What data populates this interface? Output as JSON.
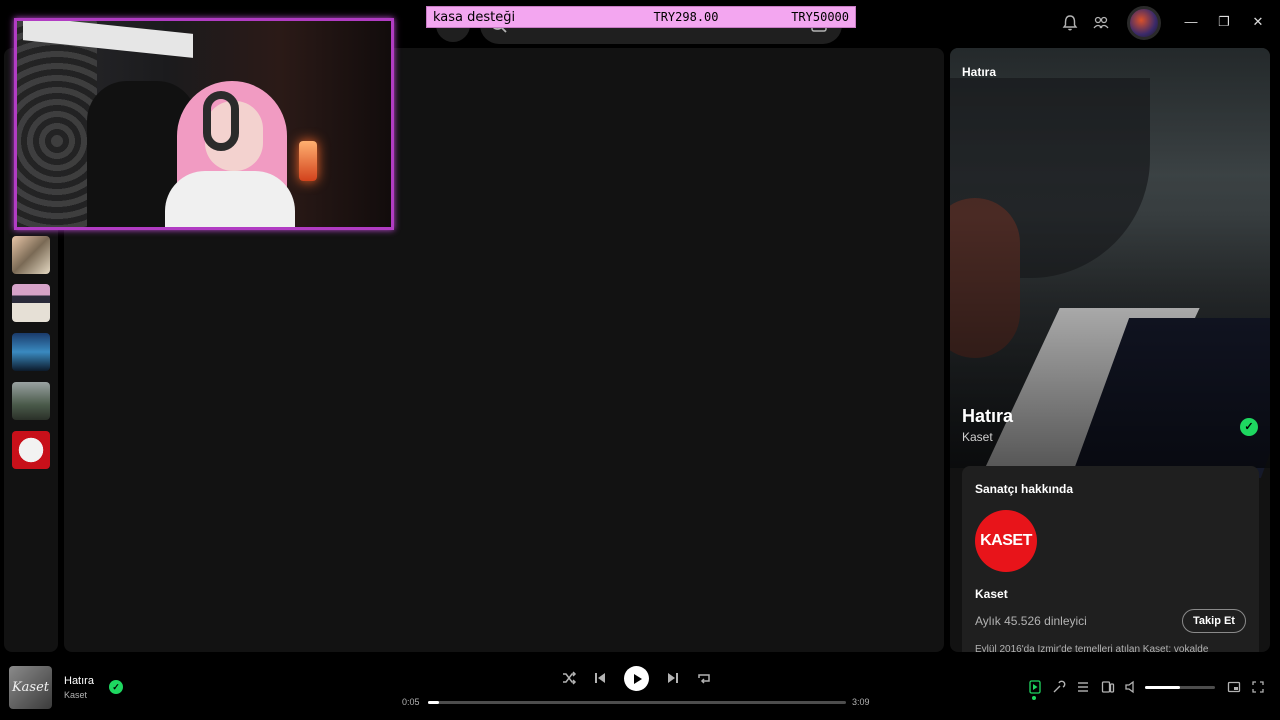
{
  "donation_overlay": {
    "title": "kasa desteği",
    "amount": "TRY298.00",
    "goal": "TRY50000"
  },
  "icons": {
    "home": "home-icon",
    "search": "search-icon",
    "browse": "browse-icon",
    "notifications": "bell-icon",
    "friends": "friends-icon",
    "minimize": "minimize-icon",
    "restore": "restore-icon",
    "close": "close-icon"
  },
  "right_panel": {
    "header": "Hatıra",
    "song_title": "Hatıra",
    "artist": "Kaset",
    "about_title": "Sanatçı hakkında",
    "about_logo_text": "KASET",
    "about_artist_name": "Kaset",
    "monthly_listeners": "Aylık 45.526 dinleyici",
    "follow_button": "Takip Et",
    "bio": "Eylül 2016'da İzmir'de temelleri atılan Kaset; vokalde"
  },
  "now_playing": {
    "title": "Hatıra",
    "artist": "Kaset",
    "art_text": "Kaset",
    "elapsed": "0:05",
    "duration": "3:09",
    "progress": 0.027,
    "volume": 0.5
  },
  "colors": {
    "accent_green": "#1ed760",
    "overlay_pink": "#f3a6f0",
    "webcam_border": "#b13cc3",
    "kaset_red": "#e8141a"
  }
}
